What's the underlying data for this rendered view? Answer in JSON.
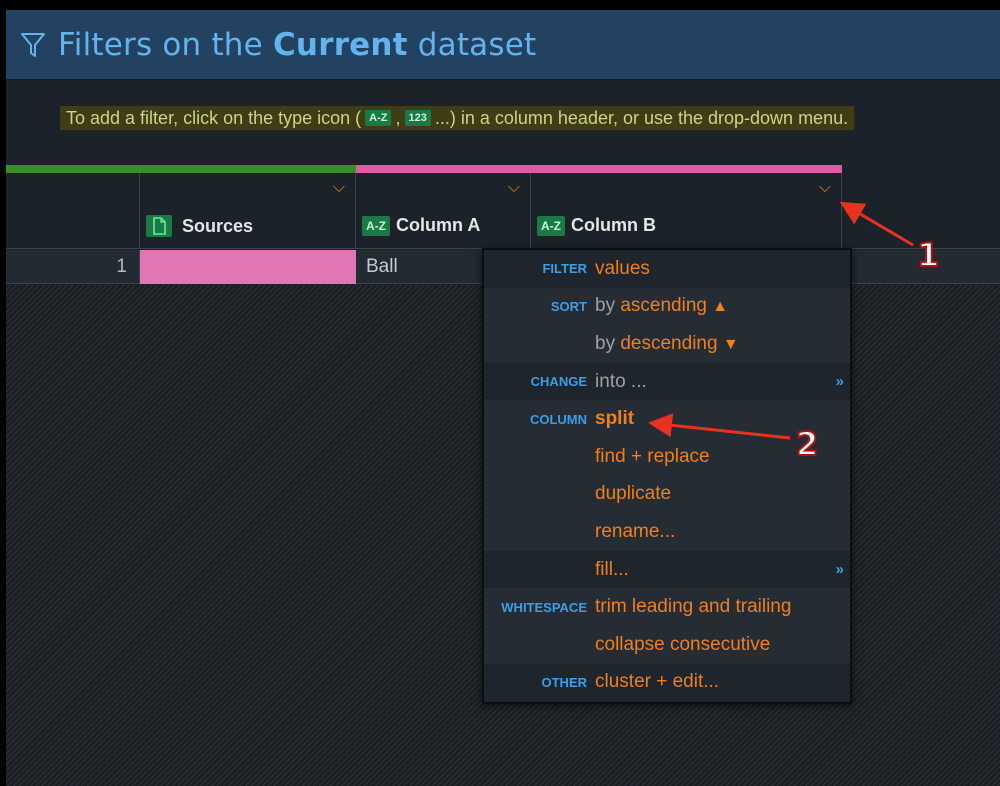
{
  "header": {
    "title_pre": "Filters on the ",
    "title_bold": "Current",
    "title_post": " dataset",
    "icon": "filter-icon"
  },
  "hint": {
    "part1": "To add a filter, click on the type icon (",
    "tag_text": "A-Z",
    "sep": ",",
    "tag_num": "123",
    "part2": "...) in a column header, or use the drop-down menu."
  },
  "columns": [
    {
      "label": "Sources",
      "icon": "document-icon",
      "type_tag": ""
    },
    {
      "label": "Column A",
      "icon": "text-type-icon",
      "type_tag": "A-Z"
    },
    {
      "label": "Column B",
      "icon": "text-type-icon",
      "type_tag": "A-Z"
    }
  ],
  "rows": [
    {
      "num": "1",
      "sources": "",
      "column_a": "Ball"
    }
  ],
  "menu": {
    "items": [
      {
        "section": "FILTER",
        "action": "values"
      },
      {
        "section": "SORT",
        "prefix": "by",
        "action": "ascending",
        "symbol": "▲"
      },
      {
        "section": "",
        "prefix": "by",
        "action": "descending",
        "symbol": "▼"
      },
      {
        "section": "CHANGE",
        "action": "into ...",
        "more": "»",
        "muted": true
      },
      {
        "section": "COLUMN",
        "action": "split",
        "bold": true
      },
      {
        "section": "",
        "action": "find + replace"
      },
      {
        "section": "",
        "action": "duplicate"
      },
      {
        "section": "",
        "action": "rename..."
      },
      {
        "section": "",
        "action": "fill...",
        "more": "»"
      },
      {
        "section": "WHITESPACE",
        "action": "trim leading and trailing"
      },
      {
        "section": "",
        "action": "collapse consecutive"
      },
      {
        "section": "OTHER",
        "action": "cluster + edit..."
      }
    ]
  },
  "callouts": {
    "one": "1",
    "two": "2"
  },
  "colors": {
    "header_bg": "#234160",
    "title": "#62b4ee",
    "accent_orange": "#f07f1d",
    "section_blue": "#3c9fe6",
    "pink": "#e15aa6",
    "green": "#3d8c2a",
    "annotation_red": "#e8321f"
  }
}
